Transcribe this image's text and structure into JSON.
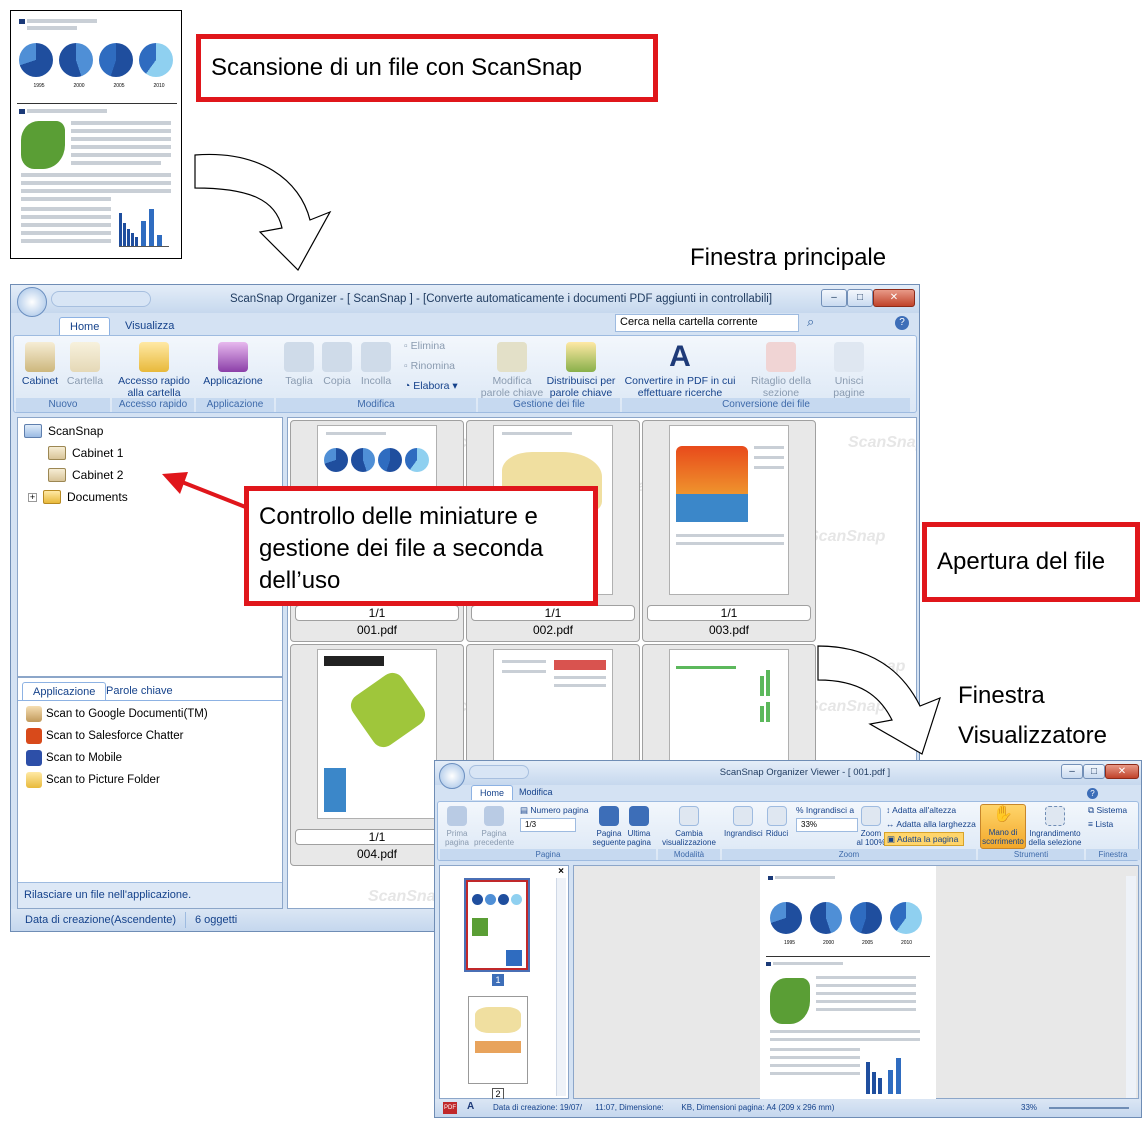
{
  "callouts": {
    "scan": "Scansione di un file con ScanSnap",
    "thumbs": "Controllo delle miniature e gestione dei file a seconda dell’uso",
    "open": "Apertura del file"
  },
  "labels": {
    "main_window": "Finestra principale",
    "viewer_window_1": "Finestra",
    "viewer_window_2": "Visualizzatore"
  },
  "doc_years": [
    "1995",
    "2000",
    "2005",
    "2010"
  ],
  "main": {
    "title": "ScanSnap Organizer - [ ScanSnap ]  - [Converte automaticamente i documenti PDF aggiunti in controllabili]",
    "tabs": [
      "Home",
      "Visualizza"
    ],
    "search_placeholder": "Cerca nella cartella corrente",
    "ribbon": {
      "cabinet": "Cabinet",
      "cartella": "Cartella",
      "accesso_1": "Accesso rapido",
      "accesso_2": "alla cartella",
      "applicazione": "Applicazione",
      "taglia": "Taglia",
      "copia": "Copia",
      "incolla": "Incolla",
      "elimina": "Elimina",
      "rinomina": "Rinomina",
      "elabora": "Elabora",
      "modifica_1": "Modifica",
      "modifica_2": "parole chiave",
      "distribuisci_1": "Distribuisci per",
      "distribuisci_2": "parole chiave",
      "convertire_1": "Convertire in PDF in cui",
      "convertire_2": "effettuare ricerche",
      "ritaglio_1": "Ritaglio della",
      "ritaglio_2": "sezione evidenziata",
      "unisci_1": "Unisci",
      "unisci_2": "pagine",
      "groups": [
        "Nuovo",
        "Accesso rapido",
        "Applicazione",
        "Modifica",
        "Gestione dei file",
        "Conversione dei file"
      ]
    },
    "tree": {
      "root": "ScanSnap",
      "items": [
        "Cabinet 1",
        "Cabinet 2",
        "Documents"
      ]
    },
    "files": [
      {
        "page": "1/1",
        "name": "001.pdf"
      },
      {
        "page": "1/1",
        "name": "002.pdf"
      },
      {
        "page": "1/1",
        "name": "003.pdf"
      },
      {
        "page": "1/1",
        "name": "004.pdf"
      }
    ],
    "watermark": "ScanSnap",
    "app_tabs": [
      "Applicazione",
      "Parole chiave"
    ],
    "apps": [
      "Scan to Google Documenti(TM)",
      "Scan to Salesforce Chatter",
      "Scan to Mobile",
      "Scan to Picture Folder"
    ],
    "app_hint": "Rilasciare un file nell'applicazione.",
    "status_sort": "Data di creazione(Ascendente)",
    "status_count": "6 oggetti"
  },
  "viewer": {
    "title": "ScanSnap Organizer Viewer - [ 001.pdf ]",
    "tabs": [
      "Home",
      "Modifica"
    ],
    "ribbon": {
      "prima_1": "Prima",
      "prima_2": "pagina",
      "precedente_1": "Pagina",
      "precedente_2": "precedente",
      "numero_pagina": "Numero pagina",
      "page_value": "1/3",
      "seguente_1": "Pagina",
      "seguente_2": "seguente",
      "ultima_1": "Ultima",
      "ultima_2": "pagina",
      "cambia_1": "Cambia",
      "cambia_2": "visualizzazione",
      "ingrandisci": "Ingrandisci",
      "riduci": "Riduci",
      "ingrandisci_a": "Ingrandisci a",
      "zoom_value": "33%",
      "zoom100_1": "Zoom",
      "zoom100_2": "al 100%",
      "adatta_altezza": "Adatta all'altezza",
      "adatta_larghezza": "Adatta alla larghezza",
      "adatta_pagina": "Adatta la pagina",
      "mano_1": "Mano di",
      "mano_2": "scorrimento",
      "ingr_sel_1": "Ingrandimento",
      "ingr_sel_2": "della selezione",
      "sistema": "Sistema",
      "lista": "Lista",
      "groups": [
        "Pagina",
        "Modalità",
        "Zoom",
        "Strumenti",
        "Finestra"
      ]
    },
    "page_numbers": [
      "1",
      "2"
    ],
    "status": "Data di creazione: 19/07/      11:07, Dimensione:        KB, Dimensioni pagina: A4 (209 x 296 mm)",
    "status_zoom": "33%"
  }
}
